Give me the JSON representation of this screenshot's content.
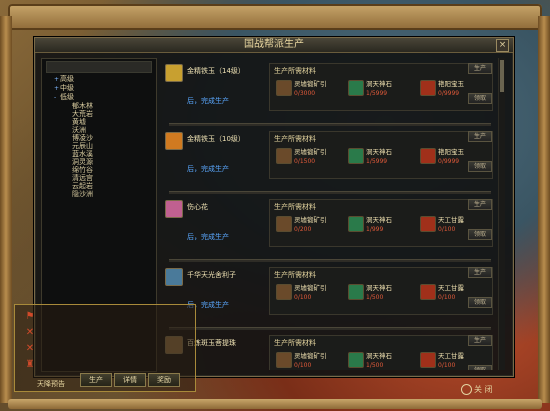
{
  "window": {
    "title": "国战帮派生产",
    "close_glyph": "×"
  },
  "tree": {
    "groups": [
      {
        "label": "高级",
        "toggle": "+"
      },
      {
        "label": "中级",
        "toggle": "+"
      },
      {
        "label": "低级",
        "toggle": "-"
      }
    ],
    "places": [
      "郁木林",
      "大荒岩",
      "黄墟",
      "沃洲",
      "博凌沙",
      "元辰山",
      "蓝水溪",
      "洞灵源",
      "绵竹谷",
      "清远宫",
      "云起岩",
      "隐沙洲"
    ]
  },
  "entries": [
    {
      "name": "金精铁玉（14级）",
      "eta": "后，完成生产",
      "mats_header": "生产所需材料",
      "mats": [
        {
          "name": "灵墟锻矿引",
          "count": "0/3000"
        },
        {
          "name": "洞天神石",
          "count": "1/5999"
        },
        {
          "name": "艳阳宝玉",
          "count": "0/9999"
        }
      ],
      "btn1": "生产",
      "btn2": "领取",
      "icon_color": "#c8a030"
    },
    {
      "name": "金精铁玉（10级）",
      "eta": "后，完成生产",
      "mats_header": "生产所需材料",
      "mats": [
        {
          "name": "灵墟锻矿引",
          "count": "0/1500"
        },
        {
          "name": "洞天神石",
          "count": "1/5999"
        },
        {
          "name": "艳阳宝玉",
          "count": "0/9999"
        }
      ],
      "btn1": "生产",
      "btn2": "领取",
      "icon_color": "#d07a20"
    },
    {
      "name": "伤心花",
      "eta": "后，完成生产",
      "mats_header": "生产所需材料",
      "mats": [
        {
          "name": "灵墟锻矿引",
          "count": "0/200"
        },
        {
          "name": "洞天神石",
          "count": "1/999"
        },
        {
          "name": "天工甘露",
          "count": "0/100"
        }
      ],
      "btn1": "生产",
      "btn2": "领取",
      "icon_color": "#c06090"
    },
    {
      "name": "千华天光舍利子",
      "eta": "后，完成生产",
      "mats_header": "生产所需材料",
      "mats": [
        {
          "name": "灵墟锻矿引",
          "count": "0/100"
        },
        {
          "name": "洞天神石",
          "count": "1/500"
        },
        {
          "name": "天工甘露",
          "count": "0/100"
        }
      ],
      "btn1": "生产",
      "btn2": "领取",
      "icon_color": "#4a7a9a"
    },
    {
      "name": "百炼斑玉菩提珠",
      "eta": "",
      "mats_header": "生产所需材料",
      "mats": [
        {
          "name": "灵墟锻矿引",
          "count": "0/100"
        },
        {
          "name": "洞天神石",
          "count": "1/500"
        },
        {
          "name": "天工甘露",
          "count": "0/100"
        }
      ],
      "btn1": "生产",
      "btn2": "领取",
      "icon_color": "#8a6a40"
    }
  ],
  "bottom": {
    "label": "天降预告",
    "tabs": [
      "生产",
      "详情",
      "奖励"
    ],
    "close": "关 闭"
  },
  "colors": {
    "accent": "#5aa8ff",
    "count_red": "#e05a3a",
    "gold": "#e8d7a0"
  }
}
